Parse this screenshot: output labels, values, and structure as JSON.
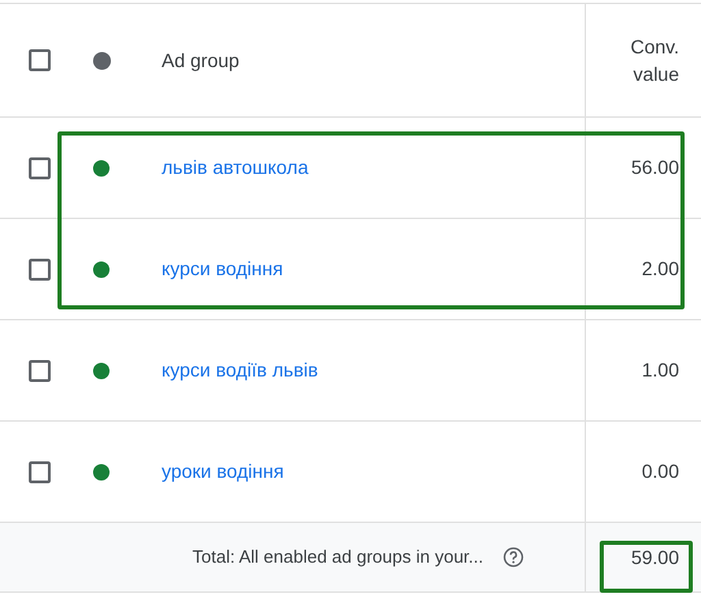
{
  "table": {
    "columns": [
      {
        "label": "Ad group"
      },
      {
        "label": "Conv.\nvalue"
      }
    ],
    "header_checkbox": {
      "checked": false
    },
    "rows": [
      {
        "name": "львів автошкола",
        "color": "#188038",
        "checked": false,
        "conv_value": "56.00",
        "highlighted": true
      },
      {
        "name": "курси водіння",
        "color": "#188038",
        "checked": false,
        "conv_value": "2.00",
        "highlighted": true
      },
      {
        "name": "курси водіїв львів",
        "color": "#188038",
        "checked": false,
        "conv_value": "1.00",
        "highlighted": false
      },
      {
        "name": "уроки водіння",
        "color": "#188038",
        "checked": false,
        "conv_value": "0.00",
        "highlighted": false
      }
    ],
    "total": {
      "label": "Total: All enabled ad groups in your...",
      "conv_value": "59.00",
      "highlighted": true
    }
  }
}
